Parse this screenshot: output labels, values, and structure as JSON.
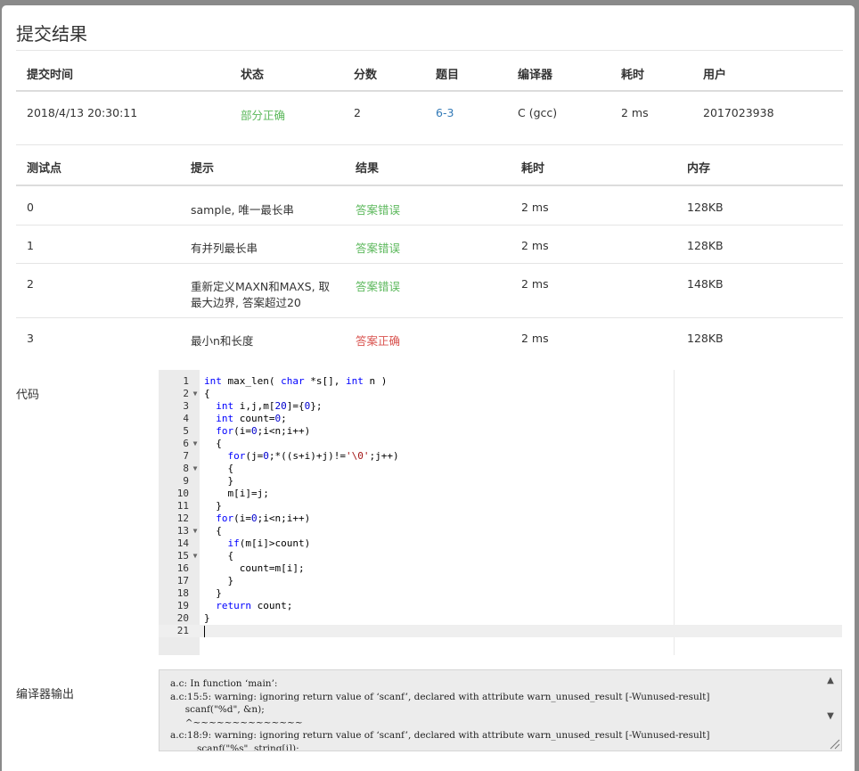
{
  "title": "提交结果",
  "summary": {
    "headers": [
      "提交时间",
      "状态",
      "分数",
      "题目",
      "编译器",
      "耗时",
      "用户"
    ],
    "row": {
      "time": "2018/4/13 20:30:11",
      "status": "部分正确",
      "score": "2",
      "problem": "6-3",
      "compiler": "C (gcc)",
      "elapsed": "2 ms",
      "user": "2017023938"
    }
  },
  "tests": {
    "headers": [
      "测试点",
      "提示",
      "结果",
      "耗时",
      "内存"
    ],
    "rows": [
      {
        "id": "0",
        "hint": "sample, 唯一最长串",
        "hint2": "",
        "result": "答案错误",
        "time": "2 ms",
        "mem": "128KB"
      },
      {
        "id": "1",
        "hint": "有并列最长串",
        "hint2": "",
        "result": "答案错误",
        "time": "2 ms",
        "mem": "128KB"
      },
      {
        "id": "2",
        "hint": "重新定义MAXN和MAXS, 取",
        "hint2": "最大边界, 答案超过20",
        "result": "答案错误",
        "time": "2 ms",
        "mem": "148KB"
      },
      {
        "id": "3",
        "hint": "最小n和长度",
        "hint2": "",
        "result": "答案正确",
        "time": "2 ms",
        "mem": "128KB"
      }
    ]
  },
  "code_label": "代码",
  "code_lines": [
    "int max_len( char *s[], int n )",
    "{",
    "  int i,j,m[20]={0};",
    "  int count=0;",
    "  for(i=0;i<n;i++)",
    "  {",
    "    for(j=0;*((s+i)+j)!='\\0';j++)",
    "    {",
    "    }",
    "    m[i]=j;",
    "  }",
    "  for(i=0;i<n;i++)",
    "  {",
    "    if(m[i]>count)",
    "    {",
    "      count=m[i];",
    "    }",
    "  }",
    "  return count;",
    "}",
    ""
  ],
  "fold_lines": [
    2,
    6,
    8,
    13,
    15
  ],
  "output_label": "编译器输出",
  "compiler_output": "a.c: In function ‘main’:\na.c:15:5: warning: ignoring return value of ‘scanf’, declared with attribute warn_unused_result [-Wunused-result]\n     scanf(\"%d\", &n);\n     ^~~~~~~~~~~~~~~\na.c:18:9: warning: ignoring return value of ‘scanf’, declared with attribute warn_unused_result [-Wunused-result]\n         scanf(\"%s\", string[i]);",
  "colors": {
    "accent": "#337ab7",
    "success": "#5cb85c",
    "error": "#d9534f"
  }
}
